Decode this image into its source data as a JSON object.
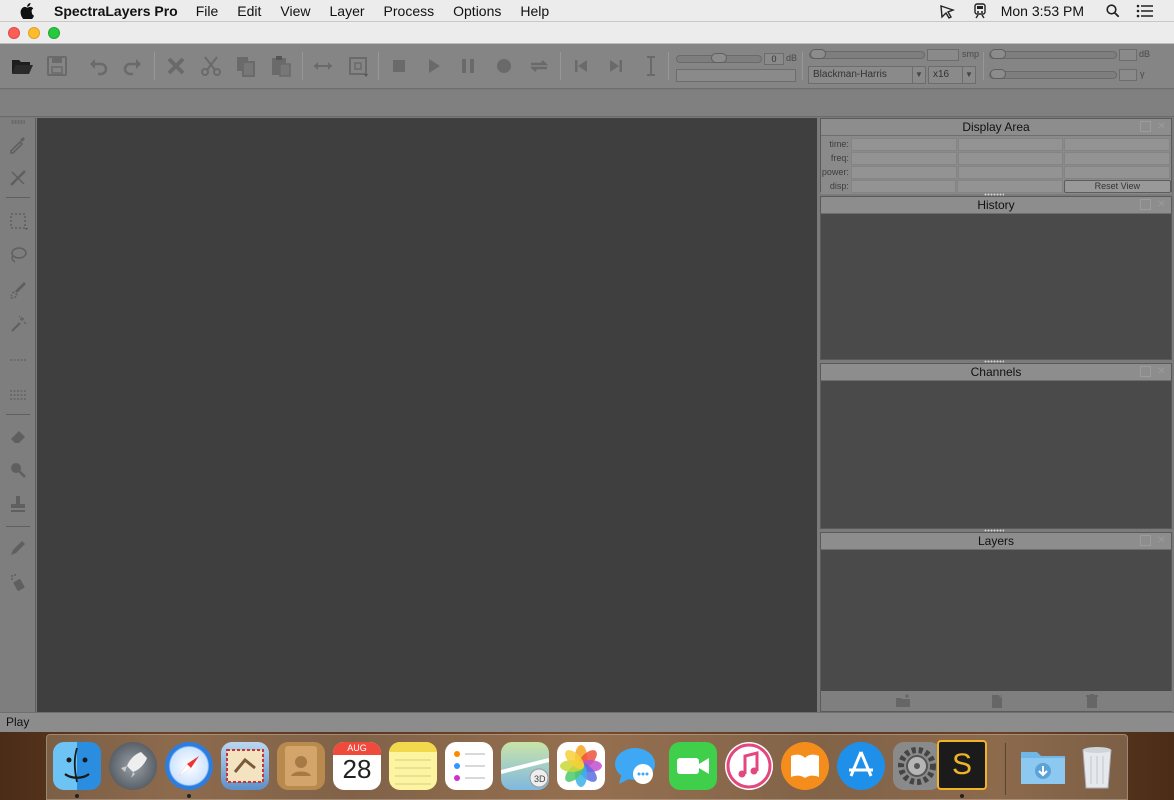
{
  "menubar": {
    "app_name": "SpectraLayers Pro",
    "menus": [
      "File",
      "Edit",
      "View",
      "Layer",
      "Process",
      "Options",
      "Help"
    ],
    "clock": "Mon 3:53 PM"
  },
  "toolbar": {
    "gain_value": "0",
    "gain_unit": "dB",
    "fft_size_unit": "smp",
    "top_right_unit": "dB",
    "gamma_unit": "γ",
    "window_function": "Blackman-Harris",
    "oversampling": "x16"
  },
  "panels": {
    "display_area": {
      "title": "Display Area",
      "rows": [
        "time:",
        "freq:",
        "power:",
        "disp:"
      ],
      "reset_label": "Reset View"
    },
    "history": {
      "title": "History"
    },
    "channels": {
      "title": "Channels"
    },
    "layers": {
      "title": "Layers"
    }
  },
  "status": {
    "text": "Play"
  },
  "dock": {
    "calendar_month": "AUG",
    "calendar_day": "28",
    "sl_letter": "S"
  },
  "colors": {
    "canvas": "#3f3f3f",
    "panel_body": "#4a4a4a",
    "chrome": "#858585",
    "accent_spectralayers": "#f0b429"
  }
}
